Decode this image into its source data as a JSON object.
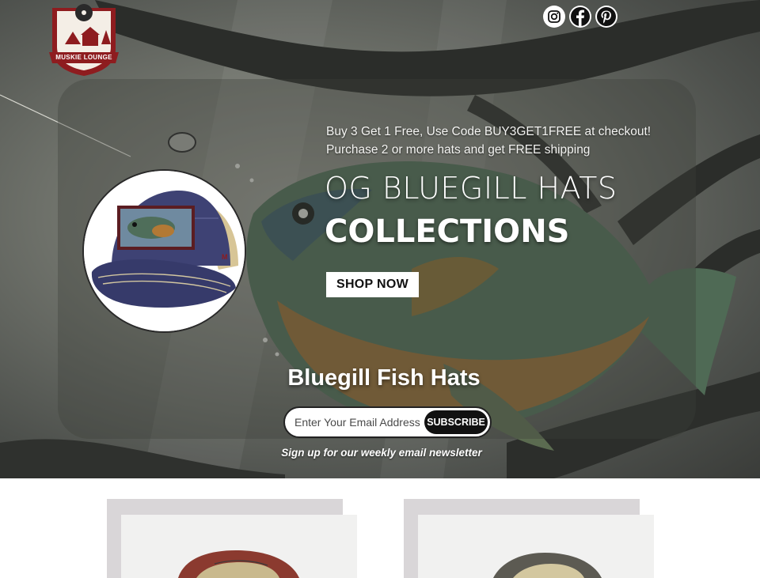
{
  "brand": {
    "logo_text": "MUSKIE LOUNGE",
    "logo_color": "#8e1c1f"
  },
  "social": [
    {
      "name": "instagram-icon",
      "glyph": "◎"
    },
    {
      "name": "facebook-icon",
      "glyph": "f"
    },
    {
      "name": "pinterest-icon",
      "glyph": "P"
    }
  ],
  "hero": {
    "promo_line_1": "Buy 3 Get 1 Free, Use Code BUY3GET1FREE at checkout!",
    "promo_line_2": "Purchase 2 or more hats and get FREE shipping",
    "headline_light": "OG BLUEGILL HATS",
    "headline_bold": "COLLECTIONS",
    "shop_button": "SHOP NOW"
  },
  "newsletter": {
    "title": "Bluegill Fish Hats",
    "email_placeholder": "Enter Your Email Address",
    "subscribe_button": "SUBSCRIBE",
    "note": "Sign up for our weekly email newsletter"
  },
  "products": [
    {
      "name": "Bluegill hat with red crown"
    },
    {
      "name": "Bluegill hat with tan crown"
    }
  ],
  "colors": {
    "accent": "#8e1c1f",
    "button_dark": "#111111",
    "panel": "#3c3e3a"
  }
}
